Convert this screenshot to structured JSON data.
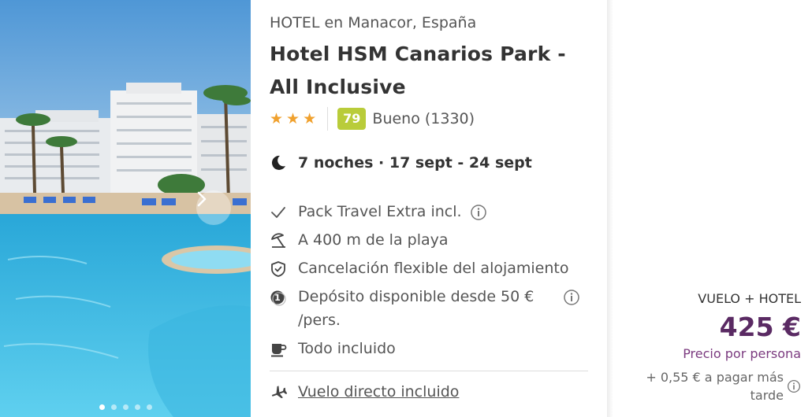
{
  "hotel": {
    "type_location": "HOTEL en Manacor, España",
    "name": "Hotel HSM Canarios Park - All Inclusive",
    "stars": 3,
    "score": "79",
    "score_text": "Bueno (1330)"
  },
  "stay": {
    "text": "7 noches · 17 sept - 24 sept"
  },
  "features": [
    {
      "icon": "check-icon",
      "text": "Pack Travel Extra incl.",
      "info": true
    },
    {
      "icon": "beach-umbrella-icon",
      "text": "A 400 m de la playa",
      "info": false
    },
    {
      "icon": "shield-check-icon",
      "text": "Cancelación flexible del alojamiento",
      "info": false
    },
    {
      "icon": "deposit-coin-icon",
      "text": "Depósito disponible desde 50 € /pers.",
      "info": true
    },
    {
      "icon": "coffee-cup-icon",
      "text": "Todo incluido",
      "info": false
    }
  ],
  "flight": {
    "icon": "airplane-icon",
    "text": "Vuelo directo incluido"
  },
  "gallery": {
    "slides": 5,
    "active_slide": 1
  },
  "price": {
    "type": "VUELO + HOTEL",
    "amount": "425 €",
    "per_person": "Precio por persona",
    "extra": "+ 0,55 € a pagar más tarde"
  },
  "colors": {
    "price": "#5a2a63",
    "per_person": "#7b3a7f",
    "score_badge": "#b9cc3a",
    "stars": "#f0a12e"
  }
}
